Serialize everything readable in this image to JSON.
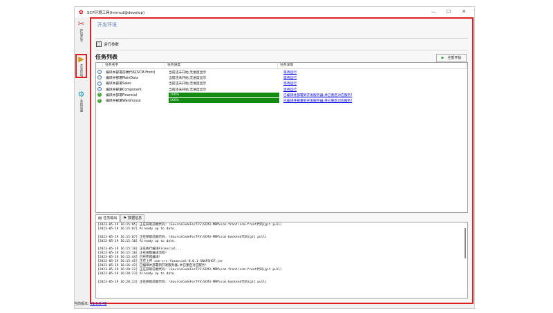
{
  "window": {
    "title": "SCP环境工具(hmncd@develop)",
    "controls": [
      "—",
      "☐",
      "✕"
    ]
  },
  "sidebar": {
    "items": [
      {
        "label": "环境开发",
        "icon": "tools-icon"
      },
      {
        "label": "开发环境",
        "icon": "file-arrow-icon"
      },
      {
        "label": "系统设置",
        "icon": "gear-icon"
      }
    ]
  },
  "main": {
    "section_title": "开发环境",
    "run_params_label": "运行参数",
    "task_list_title": "任务列表",
    "start_all_label": "全部开始",
    "columns": [
      "任务名字",
      "任务进度",
      "任务详情"
    ],
    "tasks": [
      {
        "status": "pending",
        "name": "编译并部署前端代码(SCM-Front)",
        "progress_text": "当前还未开始,无进度显示",
        "detail": "等待运行"
      },
      {
        "status": "pending",
        "name": "编译并部署MainData",
        "progress_text": "当前还未开始,无进度显示",
        "detail": "等待运行"
      },
      {
        "status": "pending",
        "name": "编译并部署Sales",
        "progress_text": "当前还未开始,无进度显示",
        "detail": "等待运行"
      },
      {
        "status": "pending",
        "name": "编译并部署Component",
        "progress_text": "当前还未开始,无进度显示",
        "detail": "等待运行"
      },
      {
        "status": "done",
        "name": "编译并部署Financial",
        "progress": 100,
        "progress_text": "100%",
        "detail": "已编译并部署到开发服务器,并已重启对应服务!"
      },
      {
        "status": "done",
        "name": "编译并部署Warehouse",
        "progress": 100,
        "progress_text": "100%",
        "detail": "已编译并部署到开发服务器,并已重启对应服务!"
      }
    ],
    "tabs": [
      {
        "label": "任务输出",
        "icon": "output-icon",
        "active": true
      },
      {
        "label": "数据信息",
        "icon": "tags-icon",
        "active": false
      }
    ],
    "log_lines": [
      "[2023-05-19 16:15:05] 正在获取前端代码: \\SourceCodeForTFS\\SCM3-MRM\\scm-front\\scm-front代码(git pull)",
      "[2023-05-19 16:15:07] Already up to date.",
      "",
      "[2023-05-19 16:15:07] 正在获取前端代码: \\SourceCodeForTFS\\SCM3-MRM\\scm-backend代码(git pull)",
      "[2023-05-19 16:15:10] Already up to date.",
      "",
      "[2023-05-19 16:15:10] 正在执行编译Financial...",
      "[2023-05-19 16:15:10] 正在函数编译流程!",
      "[2023-05-19 16:15:44] 已经完成编译!",
      "[2023-05-19 16:15:45] 正在上传 scm-srv-financial-0.0.1-SNAPSHOT.jar",
      "[2023-05-19 16:16:43] 已编译并部署到开发服务器,并已重启对应服务!",
      "[2023-05-19 16:28:22] 正在获取前端代码: \\SourceCodeForTFS\\SCM3-MRM\\scm-front\\scm-front代码(git pull)",
      "[2023-05-19 16:28:23] Already up to date.",
      "",
      "[2023-05-19 16:28:23] 正在获取前端代码: \\SourceCodeForTFS\\SCM3-MRM\\scm-backend代码(git pull)"
    ]
  },
  "footer": {
    "label": "当前版本:",
    "version": "V1.0.0.45"
  }
}
